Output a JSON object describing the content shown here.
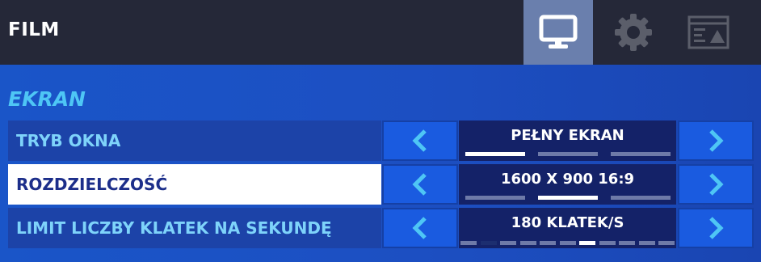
{
  "header": {
    "title": "FILM",
    "tabs": [
      {
        "icon": "monitor-icon",
        "active": true
      },
      {
        "icon": "gear-icon",
        "active": false
      },
      {
        "icon": "ui-layout-icon",
        "active": false
      }
    ]
  },
  "section": {
    "title": "EKRAN"
  },
  "settings": [
    {
      "label": "TRYB OKNA",
      "value": "PEŁNY EKRAN",
      "options_count": 3,
      "selected_index": 0
    },
    {
      "label": "ROZDZIELCZOŚĆ",
      "value": "1600 X 900 16:9",
      "options_count": 3,
      "selected_index": 1
    },
    {
      "label": "LIMIT LICZBY KLATEK NA SEKUNDĘ",
      "value": "180 KLATEK/S",
      "options_count": 11,
      "selected_index": 6
    }
  ],
  "colors": {
    "accent_text": "#4ec6f5",
    "arrow_glyph": "#4ec6f5",
    "row_background": "#1c43a8",
    "selected_row_background": "#ffffff",
    "value_box": "#142268",
    "topbar": "#252838"
  }
}
